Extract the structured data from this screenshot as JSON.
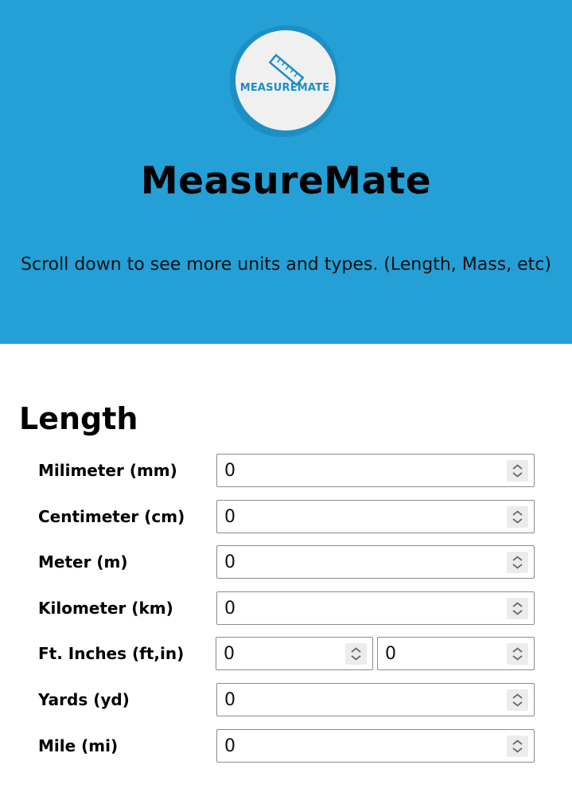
{
  "header": {
    "logo_text": "MEASUREMATE",
    "title": "MeasureMate",
    "subtitle": "Scroll down to see more units and types. (Length, Mass, etc)"
  },
  "length": {
    "title": "Length",
    "rows": [
      {
        "label": "Milimeter (mm)",
        "value": "0"
      },
      {
        "label": "Centimeter (cm)",
        "value": "0"
      },
      {
        "label": "Meter (m)",
        "value": "0"
      },
      {
        "label": "Kilometer (km)",
        "value": "0"
      },
      {
        "label": "Ft. Inches (ft,in)",
        "feet": "0",
        "inches": "0"
      },
      {
        "label": "Yards (yd)",
        "value": "0"
      },
      {
        "label": "Mile (mi)",
        "value": "0"
      }
    ]
  },
  "colors": {
    "header_bg": "#24a0d6",
    "logo_accent": "#1a8fc8"
  }
}
